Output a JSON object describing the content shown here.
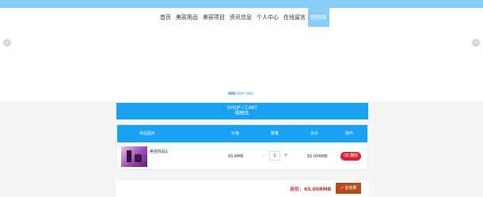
{
  "nav": {
    "items": [
      "首页",
      "美容用品",
      "美容项目",
      "资讯信息",
      "个人中心",
      "在线留言",
      "购物车"
    ]
  },
  "banner": {
    "prev_icon": "chevron-left-icon",
    "next_icon": "chevron-right-icon",
    "dots": 3,
    "active_dot": 0
  },
  "cart": {
    "title": "SHOP / CART",
    "subtitle": "购物车",
    "columns": [
      "商品图片",
      "价格",
      "数量",
      "总价",
      "操作"
    ],
    "items": [
      {
        "name": "美容商品1",
        "price": "65 RMB",
        "quantity": "1",
        "total": "65.00RMB",
        "delete_label": "删除"
      }
    ],
    "total_label": "总价：65.00RMB",
    "checkout_label": "去结算"
  },
  "colors": {
    "primary": "#19a1f3",
    "topbar": "#87cdf7",
    "danger": "#d7262d",
    "checkout": "#b94a1f"
  }
}
